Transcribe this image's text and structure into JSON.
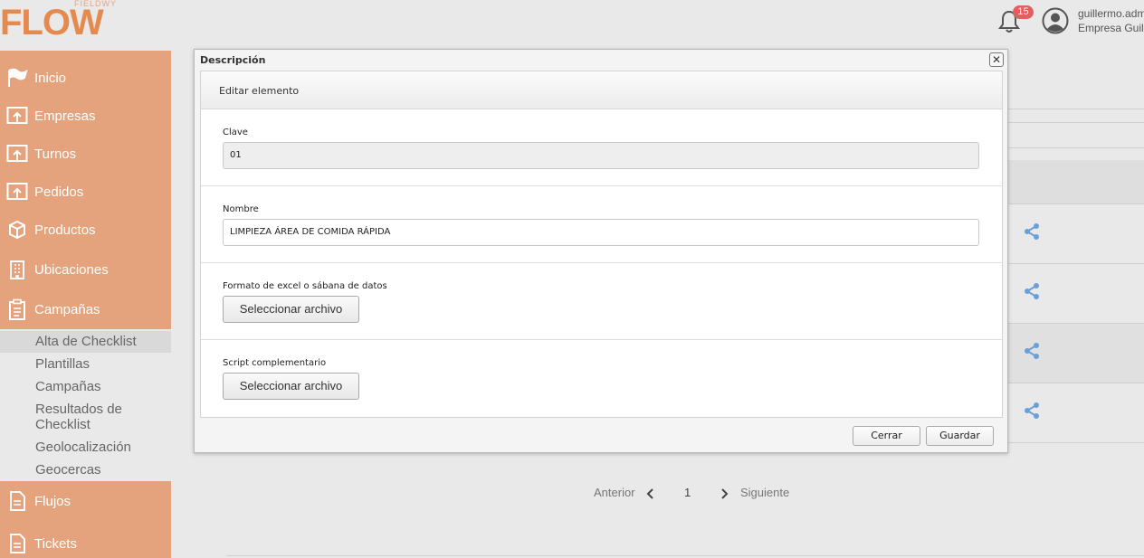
{
  "header": {
    "logo_small": "FIELDWY",
    "logo_big": "FLOW",
    "notifications_count": "15",
    "user_name": "guillermo.adm",
    "user_company": "Empresa Guille"
  },
  "sidebar": {
    "items": [
      {
        "label": "Inicio",
        "icon": "flag-icon"
      },
      {
        "label": "Empresas",
        "icon": "upload-screen-icon"
      },
      {
        "label": "Turnos",
        "icon": "upload-screen-icon"
      },
      {
        "label": "Pedidos",
        "icon": "upload-screen-icon"
      },
      {
        "label": "Productos",
        "icon": "box-icon"
      },
      {
        "label": "Ubicaciones",
        "icon": "building-icon"
      },
      {
        "label": "Campañas",
        "icon": "clipboard-icon"
      }
    ],
    "submenu": [
      {
        "label": "Alta de Checklist",
        "active": true
      },
      {
        "label": "Plantillas"
      },
      {
        "label": "Campañas"
      },
      {
        "label": "Resultados de Checklist"
      },
      {
        "label": "Geolocalización"
      },
      {
        "label": "Geocercas"
      }
    ],
    "bottom_items": [
      {
        "label": "Flujos",
        "icon": "document-icon"
      },
      {
        "label": "Tickets",
        "icon": "document-icon"
      }
    ]
  },
  "pager": {
    "prev_label": "Anterior",
    "page": "1",
    "next_label": "Siguiente"
  },
  "modal": {
    "title": "Descripción",
    "panel_title": "Editar elemento",
    "clave_label": "Clave",
    "clave_value": "01",
    "nombre_label": "Nombre",
    "nombre_value": "LIMPIEZA ÁREA DE COMIDA RÁPIDA",
    "formato_label": "Formato de excel o sábana de datos",
    "formato_button": "Seleccionar archivo",
    "script_label": "Script complementario",
    "script_button": "Seleccionar archivo",
    "close_button": "Cerrar",
    "save_button": "Guardar"
  },
  "colors": {
    "sidebar": "#e4a37c",
    "brand": "#e58a4e",
    "badge": "#e05f5f",
    "share_icon": "#6a9fd8"
  }
}
